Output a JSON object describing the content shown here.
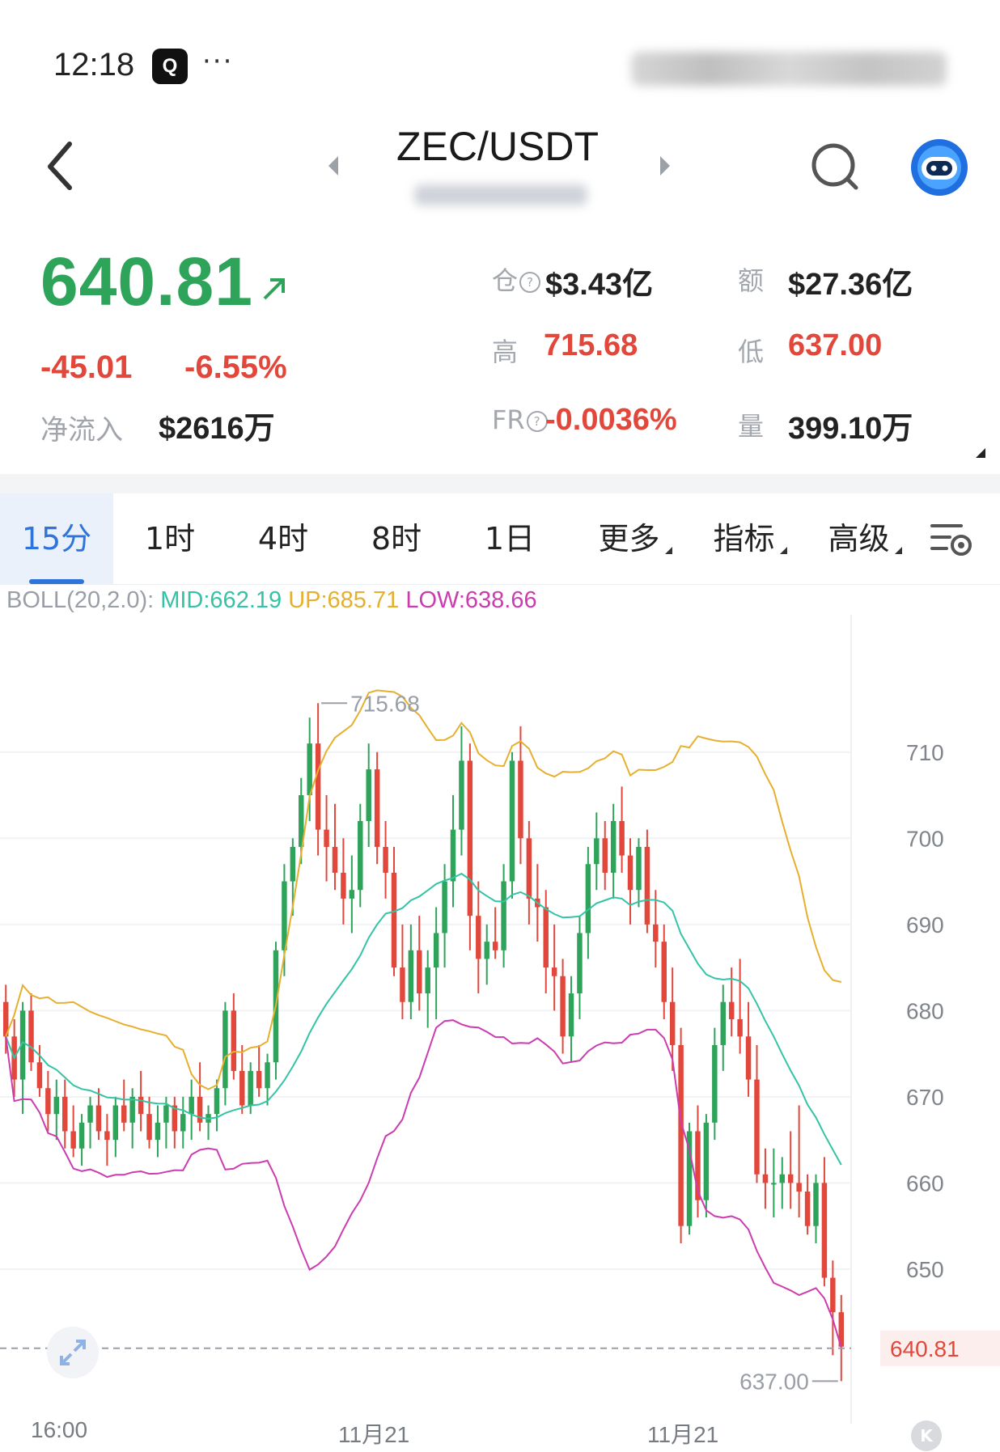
{
  "status_bar": {
    "time": "12:18",
    "app_icon": "app-icon",
    "more": "···"
  },
  "header": {
    "title": "ZEC/USDT",
    "back_icon": "back-chevron-icon",
    "search_icon": "search-icon",
    "bot_icon": "robot-assistant-icon"
  },
  "ticker": {
    "last_price": "640.81",
    "change": "-45.01",
    "change_pct": "-6.55%",
    "net_inflow_label": "净流入",
    "net_inflow": "$2616万"
  },
  "stats": {
    "open_interest_label": "仓",
    "open_interest": "$3.43亿",
    "turnover_label": "额",
    "turnover": "$27.36亿",
    "high_label": "高",
    "high": "715.68",
    "low_label": "低",
    "low": "637.00",
    "funding_label": "FR",
    "funding": "-0.0036%",
    "volume_label": "量",
    "volume": "399.10万"
  },
  "tabs": [
    {
      "label": "15分",
      "active": true
    },
    {
      "label": "1时"
    },
    {
      "label": "4时"
    },
    {
      "label": "8时"
    },
    {
      "label": "1日"
    },
    {
      "label": "更多",
      "dropdown": true
    },
    {
      "label": "指标",
      "dropdown": true
    },
    {
      "label": "高级",
      "dropdown": true
    }
  ],
  "boll": {
    "name": "BOLL(20,2.0):",
    "mid": "MID:662.19",
    "up": "UP:685.71",
    "low": "LOW:638.66"
  },
  "colors": {
    "up": "#2ea45a",
    "down": "#e2473b",
    "accent": "#2f74d9",
    "mid_band": "#35c3a5",
    "upper_band": "#e6b02e",
    "lower_band": "#cc3cb0"
  },
  "chart_data": {
    "type": "candlestick",
    "y_ticks": [
      "710",
      "700",
      "690",
      "680",
      "670",
      "660",
      "650"
    ],
    "ylim": [
      633,
      725
    ],
    "x_labels": [
      "16:00",
      "11月21",
      "11月21"
    ],
    "max_label": "715.68",
    "min_label": "637.00",
    "last_label": "640.81",
    "candles": [
      [
        681,
        683,
        675,
        677
      ],
      [
        677,
        679,
        670,
        672
      ],
      [
        672,
        681,
        668,
        680
      ],
      [
        680,
        682,
        673,
        674
      ],
      [
        674,
        676,
        670,
        671
      ],
      [
        671,
        673,
        666,
        668
      ],
      [
        668,
        672,
        665,
        670
      ],
      [
        670,
        672,
        664,
        666
      ],
      [
        666,
        669,
        663,
        664
      ],
      [
        664,
        668,
        662,
        667
      ],
      [
        667,
        670,
        664,
        669
      ],
      [
        669,
        671,
        665,
        666
      ],
      [
        666,
        668,
        662,
        665
      ],
      [
        665,
        670,
        663,
        669
      ],
      [
        669,
        672,
        666,
        667
      ],
      [
        667,
        671,
        664,
        670
      ],
      [
        670,
        673,
        666,
        668
      ],
      [
        668,
        670,
        664,
        665
      ],
      [
        665,
        669,
        663,
        667
      ],
      [
        667,
        670,
        664,
        669
      ],
      [
        669,
        670,
        664,
        666
      ],
      [
        666,
        670,
        664,
        668
      ],
      [
        668,
        672,
        665,
        670
      ],
      [
        670,
        674,
        666,
        667
      ],
      [
        667,
        669,
        665,
        668
      ],
      [
        668,
        672,
        666,
        671
      ],
      [
        671,
        681,
        669,
        680
      ],
      [
        680,
        682,
        672,
        673
      ],
      [
        673,
        676,
        668,
        669
      ],
      [
        669,
        674,
        668,
        673
      ],
      [
        673,
        676,
        670,
        671
      ],
      [
        671,
        675,
        669,
        674
      ],
      [
        674,
        688,
        672,
        687
      ],
      [
        687,
        697,
        684,
        695
      ],
      [
        695,
        700,
        691,
        699
      ],
      [
        699,
        707,
        697,
        705
      ],
      [
        705,
        714,
        702,
        711
      ],
      [
        711,
        715.68,
        698,
        701
      ],
      [
        701,
        705,
        695,
        699
      ],
      [
        699,
        704,
        694,
        696
      ],
      [
        696,
        700,
        690,
        693
      ],
      [
        693,
        698,
        689,
        694
      ],
      [
        694,
        704,
        692,
        702
      ],
      [
        702,
        711,
        699,
        708
      ],
      [
        708,
        710,
        697,
        699
      ],
      [
        699,
        702,
        693,
        696
      ],
      [
        696,
        699,
        684,
        685
      ],
      [
        685,
        690,
        679,
        681
      ],
      [
        681,
        690,
        679,
        687
      ],
      [
        687,
        691,
        680,
        682
      ],
      [
        682,
        687,
        678,
        685
      ],
      [
        685,
        692,
        679,
        689
      ],
      [
        689,
        697,
        685,
        695
      ],
      [
        695,
        705,
        692,
        701
      ],
      [
        701,
        713,
        698,
        709
      ],
      [
        709,
        711,
        687,
        691
      ],
      [
        691,
        695,
        682,
        686
      ],
      [
        686,
        690,
        683,
        688
      ],
      [
        688,
        692,
        686,
        687
      ],
      [
        687,
        697,
        685,
        695
      ],
      [
        695,
        710,
        693,
        709
      ],
      [
        709,
        713,
        697,
        700
      ],
      [
        700,
        702,
        690,
        693
      ],
      [
        693,
        697,
        688,
        692
      ],
      [
        692,
        694,
        682,
        685
      ],
      [
        685,
        690,
        680,
        684
      ],
      [
        684,
        686,
        675,
        677
      ],
      [
        677,
        684,
        674,
        682
      ],
      [
        682,
        691,
        679,
        689
      ],
      [
        689,
        699,
        686,
        697
      ],
      [
        697,
        703,
        694,
        700
      ],
      [
        700,
        702,
        694,
        696
      ],
      [
        696,
        704,
        693,
        702
      ],
      [
        702,
        706,
        696,
        698
      ],
      [
        698,
        700,
        690,
        694
      ],
      [
        694,
        700,
        692,
        699
      ],
      [
        699,
        701,
        689,
        690
      ],
      [
        690,
        694,
        685,
        688
      ],
      [
        688,
        690,
        679,
        681
      ],
      [
        681,
        685,
        673,
        676
      ],
      [
        676,
        678,
        653,
        655
      ],
      [
        655,
        667,
        654,
        666
      ],
      [
        666,
        669,
        656,
        658
      ],
      [
        658,
        668,
        656,
        667
      ],
      [
        667,
        678,
        665,
        676
      ],
      [
        676,
        683,
        673,
        681
      ],
      [
        681,
        685,
        677,
        679
      ],
      [
        679,
        686,
        675,
        677
      ],
      [
        677,
        681,
        670,
        672
      ],
      [
        672,
        676,
        660,
        661
      ],
      [
        661,
        664,
        657,
        660
      ],
      [
        660,
        664,
        656,
        660
      ],
      [
        660,
        663,
        657,
        661
      ],
      [
        661,
        666,
        657,
        660
      ],
      [
        660,
        669,
        656,
        659
      ],
      [
        659,
        661,
        654,
        655
      ],
      [
        655,
        661,
        653,
        660
      ],
      [
        660,
        663,
        648,
        649
      ],
      [
        649,
        651,
        640,
        645
      ],
      [
        645,
        647,
        637,
        641
      ]
    ]
  }
}
